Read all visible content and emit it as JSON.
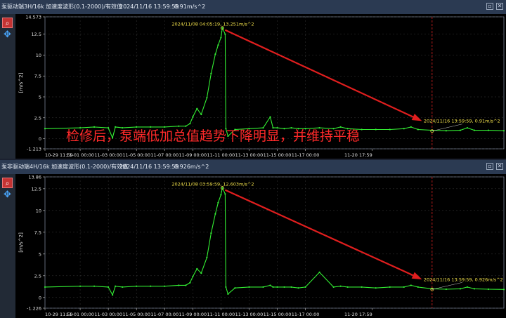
{
  "panels": [
    {
      "title_name": "泵驱动端3H/16k 加速度波形(0.1-2000)/有效值",
      "title_time": "2024/11/16 13:59:59",
      "title_value": "0.91m/s^2",
      "chart_data": {
        "type": "line",
        "ylabel": "[m/s^2]",
        "ylim": [
          -1.213,
          14.573
        ],
        "y_ticks": [
          "-1.213",
          "0",
          "2.5",
          "5",
          "7.5",
          "10",
          "12.5",
          "14.573"
        ],
        "x_ticks": [
          "10-29 11:59",
          "11-01 00:00",
          "11-03 00:00",
          "11-05 00:00",
          "11-07 00:00",
          "11-09 00:00",
          "11-11 00:00",
          "11-13 00:00",
          "11-15 00:00",
          "11-17 00:00",
          "11-20 17:59"
        ],
        "series": [
          {
            "color": "#33ee33",
            "x": [
              -2.5,
              0,
              1,
              2,
              2.3,
              2.5,
              3,
              4,
              5,
              6,
              7,
              7.5,
              7.8,
              8,
              8.3,
              8.6,
              9,
              9.3,
              9.6,
              9.8,
              10,
              10.1,
              10.3,
              10.35,
              10.5,
              11,
              12,
              13,
              13.5,
              13.7,
              14,
              14.5,
              15,
              15.5,
              16,
              17,
              18,
              18.5,
              19,
              20,
              21,
              22,
              23,
              23.5,
              24,
              25,
              26,
              27,
              27.5,
              28,
              29,
              30.1
            ],
            "y": [
              1.2,
              1.3,
              1.4,
              1.3,
              0.1,
              1.4,
              1.3,
              1.4,
              1.4,
              1.4,
              1.5,
              1.5,
              1.8,
              2.6,
              3.6,
              2.9,
              4.9,
              7.8,
              10.1,
              11.2,
              12.1,
              13.251,
              12.5,
              1.2,
              0.3,
              1.1,
              1.2,
              1.3,
              2.6,
              1.3,
              1.3,
              1.2,
              1.3,
              1.2,
              1.2,
              1.3,
              1.2,
              1.4,
              1.2,
              1.1,
              1.1,
              1.1,
              1.2,
              1.4,
              1.1,
              1.0,
              0.95,
              1.0,
              1.3,
              1.0,
              1.0,
              0.95
            ]
          }
        ],
        "markers": [
          {
            "x": 10.1,
            "y": 13.251,
            "label": "2024/11/08 04:05:19, 13.251m/s^2"
          },
          {
            "x": 25.0,
            "y": 0.91,
            "label": "2024/11/16 13:59:59, 0.91m/s^2"
          }
        ],
        "cursor_x": 25.0,
        "annotation": "检修后，泵端低加总值趋势下降明显，并维持平稳"
      }
    },
    {
      "title_name": "泵非驱动端4H/16k 加速度波形(0.1-2000)/有效值",
      "title_time": "2024/11/16 13:59:59",
      "title_value": "0.926m/s^2",
      "chart_data": {
        "type": "line",
        "ylabel": "[m/s^2]",
        "ylim": [
          -1.226,
          13.86
        ],
        "y_ticks": [
          "-1.226",
          "0",
          "2.5",
          "5",
          "7.5",
          "10",
          "12.5",
          "13.86"
        ],
        "x_ticks": [
          "10-29 11:59",
          "11-01 00:00",
          "11-03 00:00",
          "11-05 00:00",
          "11-07 00:00",
          "11-09 00:00",
          "11-11 00:00",
          "11-13 00:00",
          "11-15 00:00",
          "11-17 00:00",
          "11-20 17:59"
        ],
        "series": [
          {
            "color": "#33ee33",
            "x": [
              -2.5,
              0,
              1,
              2,
              2.3,
              2.5,
              3,
              4,
              5,
              6,
              7,
              7.5,
              7.8,
              8,
              8.3,
              8.6,
              9,
              9.3,
              9.6,
              9.8,
              10,
              10.1,
              10.3,
              10.35,
              10.5,
              11,
              12,
              13,
              13.5,
              13.7,
              14,
              14.5,
              15,
              15.5,
              16,
              17,
              18,
              18.5,
              19,
              20,
              21,
              22,
              23,
              23.5,
              24,
              25,
              26,
              27,
              27.5,
              28,
              29,
              30.1
            ],
            "y": [
              1.2,
              1.3,
              1.3,
              1.2,
              0.3,
              1.3,
              1.2,
              1.3,
              1.3,
              1.3,
              1.4,
              1.4,
              1.7,
              2.4,
              3.3,
              2.8,
              4.6,
              7.4,
              9.6,
              10.9,
              11.8,
              12.603,
              11.9,
              1.2,
              0.4,
              1.1,
              1.2,
              1.2,
              1.4,
              1.2,
              1.2,
              1.2,
              1.2,
              1.1,
              1.2,
              2.9,
              1.2,
              1.3,
              1.2,
              1.2,
              1.1,
              1.2,
              1.2,
              1.4,
              1.2,
              1.0,
              0.95,
              1.0,
              1.2,
              1.0,
              0.95,
              0.926
            ]
          }
        ],
        "markers": [
          {
            "x": 10.1,
            "y": 12.603,
            "label": "2024/11/08 03:59:59, 12.603m/s^2"
          },
          {
            "x": 25.0,
            "y": 0.926,
            "label": "2024/11/16 13:59:59, 0.926m/s^2"
          }
        ],
        "cursor_x": 25.0,
        "annotation": ""
      }
    }
  ],
  "icons": {
    "zoom": "magnifier-icon",
    "pan": "move-arrows-icon",
    "window": "window-restore-icon",
    "close": "close-icon"
  }
}
